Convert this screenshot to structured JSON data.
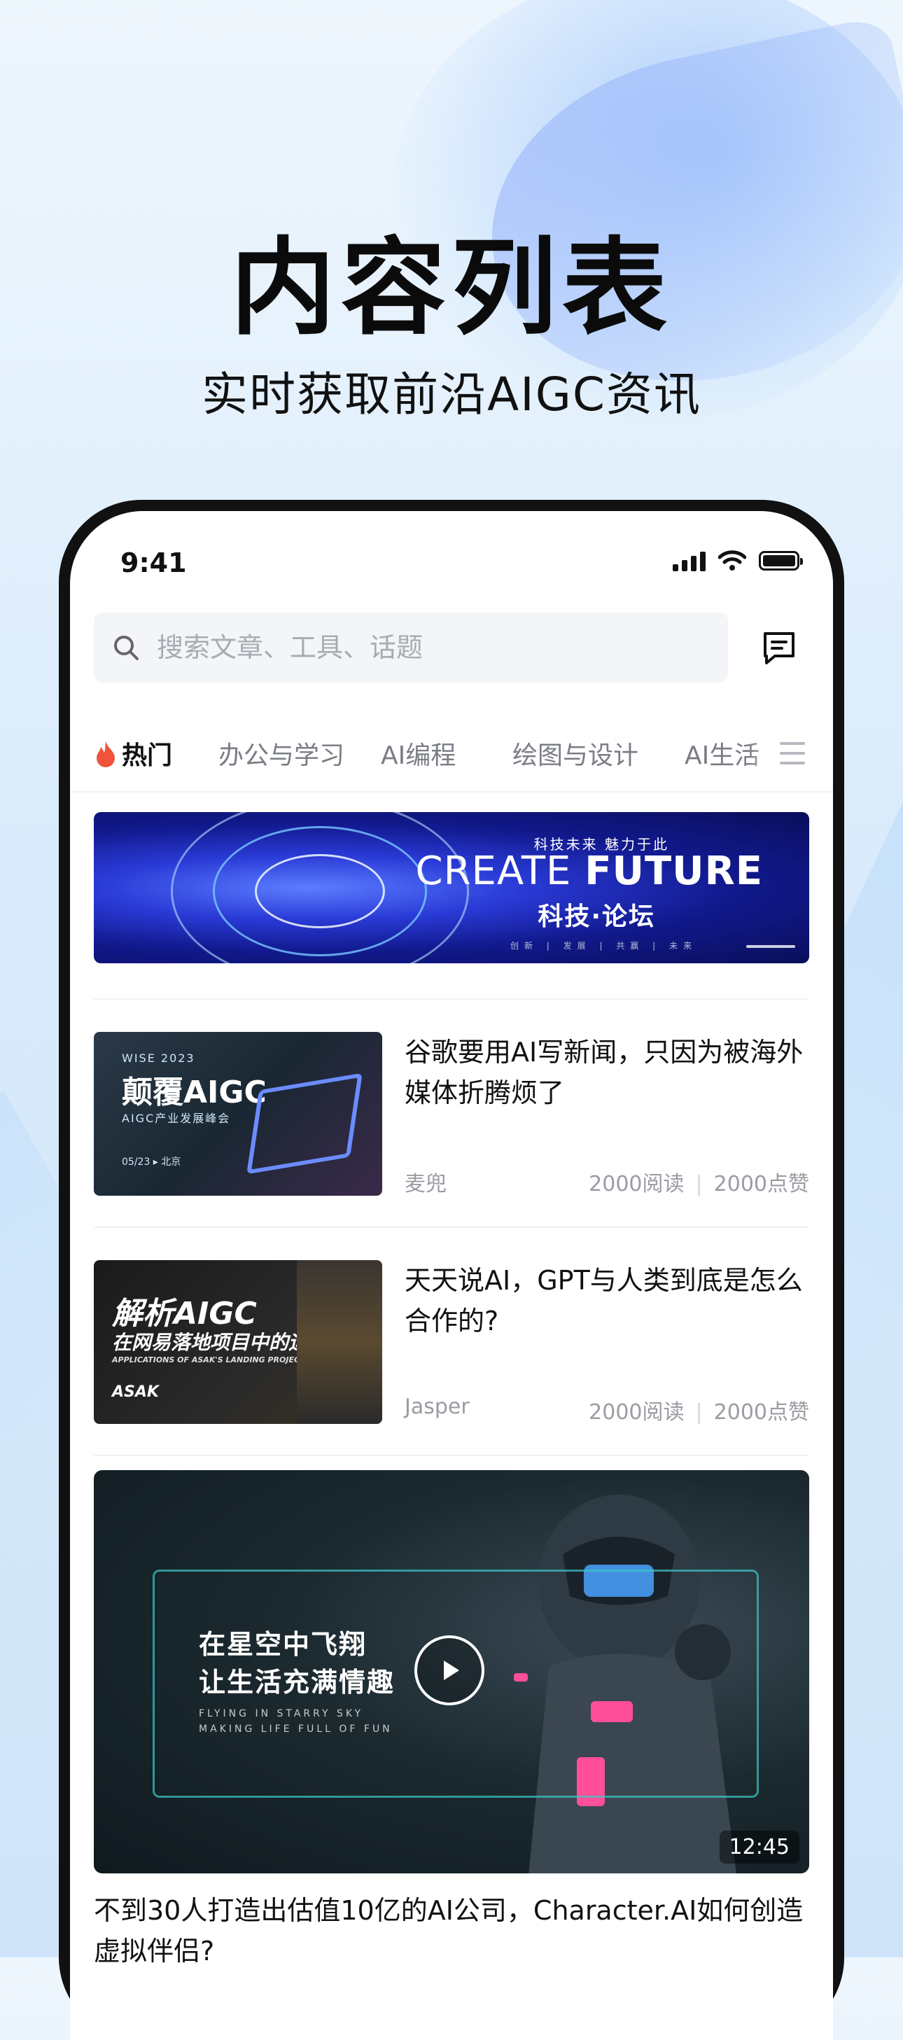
{
  "hero": {
    "title": "内容列表",
    "subtitle": "实时获取前沿AIGC资讯"
  },
  "status_bar": {
    "time": "9:41"
  },
  "search": {
    "placeholder": "搜索文章、工具、话题"
  },
  "tabs": [
    {
      "label": "热门",
      "active": true
    },
    {
      "label": "办公与学习"
    },
    {
      "label": "AI编程"
    },
    {
      "label": "绘图与设计"
    },
    {
      "label": "AI生活"
    }
  ],
  "banner": {
    "tagline": "科技未来 魅力于此",
    "headline_light": "CREATE ",
    "headline_bold": "FUTURE",
    "subtitle": "科技·论坛",
    "footer": "创新 | 发展 | 共赢 | 未来"
  },
  "articles": [
    {
      "title": "谷歌要用AI写新闻，只因为被海外媒体折腾烦了",
      "author": "麦兜",
      "reads": "2000阅读",
      "likes": "2000点赞",
      "thumb": {
        "line1": "WISE 2023",
        "line2": "颠覆AIGC",
        "line3": "AIGC产业发展峰会",
        "line4": "05/23 ▸ 北京"
      }
    },
    {
      "title": "天天说AI，GPT与人类到底是怎么合作的?",
      "author": "Jasper",
      "reads": "2000阅读",
      "likes": "2000点赞",
      "thumb": {
        "line1": "解析AIGC",
        "line2": "在网易落地项目中的运用",
        "line3": "APPLICATIONS OF ASAK'S LANDING PROJECTS IN AIGC",
        "line4": "ASAK"
      }
    }
  ],
  "video": {
    "line1": "在星空中飞翔",
    "line2": "让生活充满情趣",
    "eng1": "FLYING IN  STARRY SKY",
    "eng2": "MAKING LIFE FULL OF FUN",
    "duration": "12:45",
    "title": "不到30人打造出估值10亿的AI公司，Character.AI如何创造虚拟伴侣?"
  },
  "colors": {
    "accent_flame": "#f0533a",
    "text_primary": "#111111",
    "text_secondary": "#9a9ca3"
  }
}
